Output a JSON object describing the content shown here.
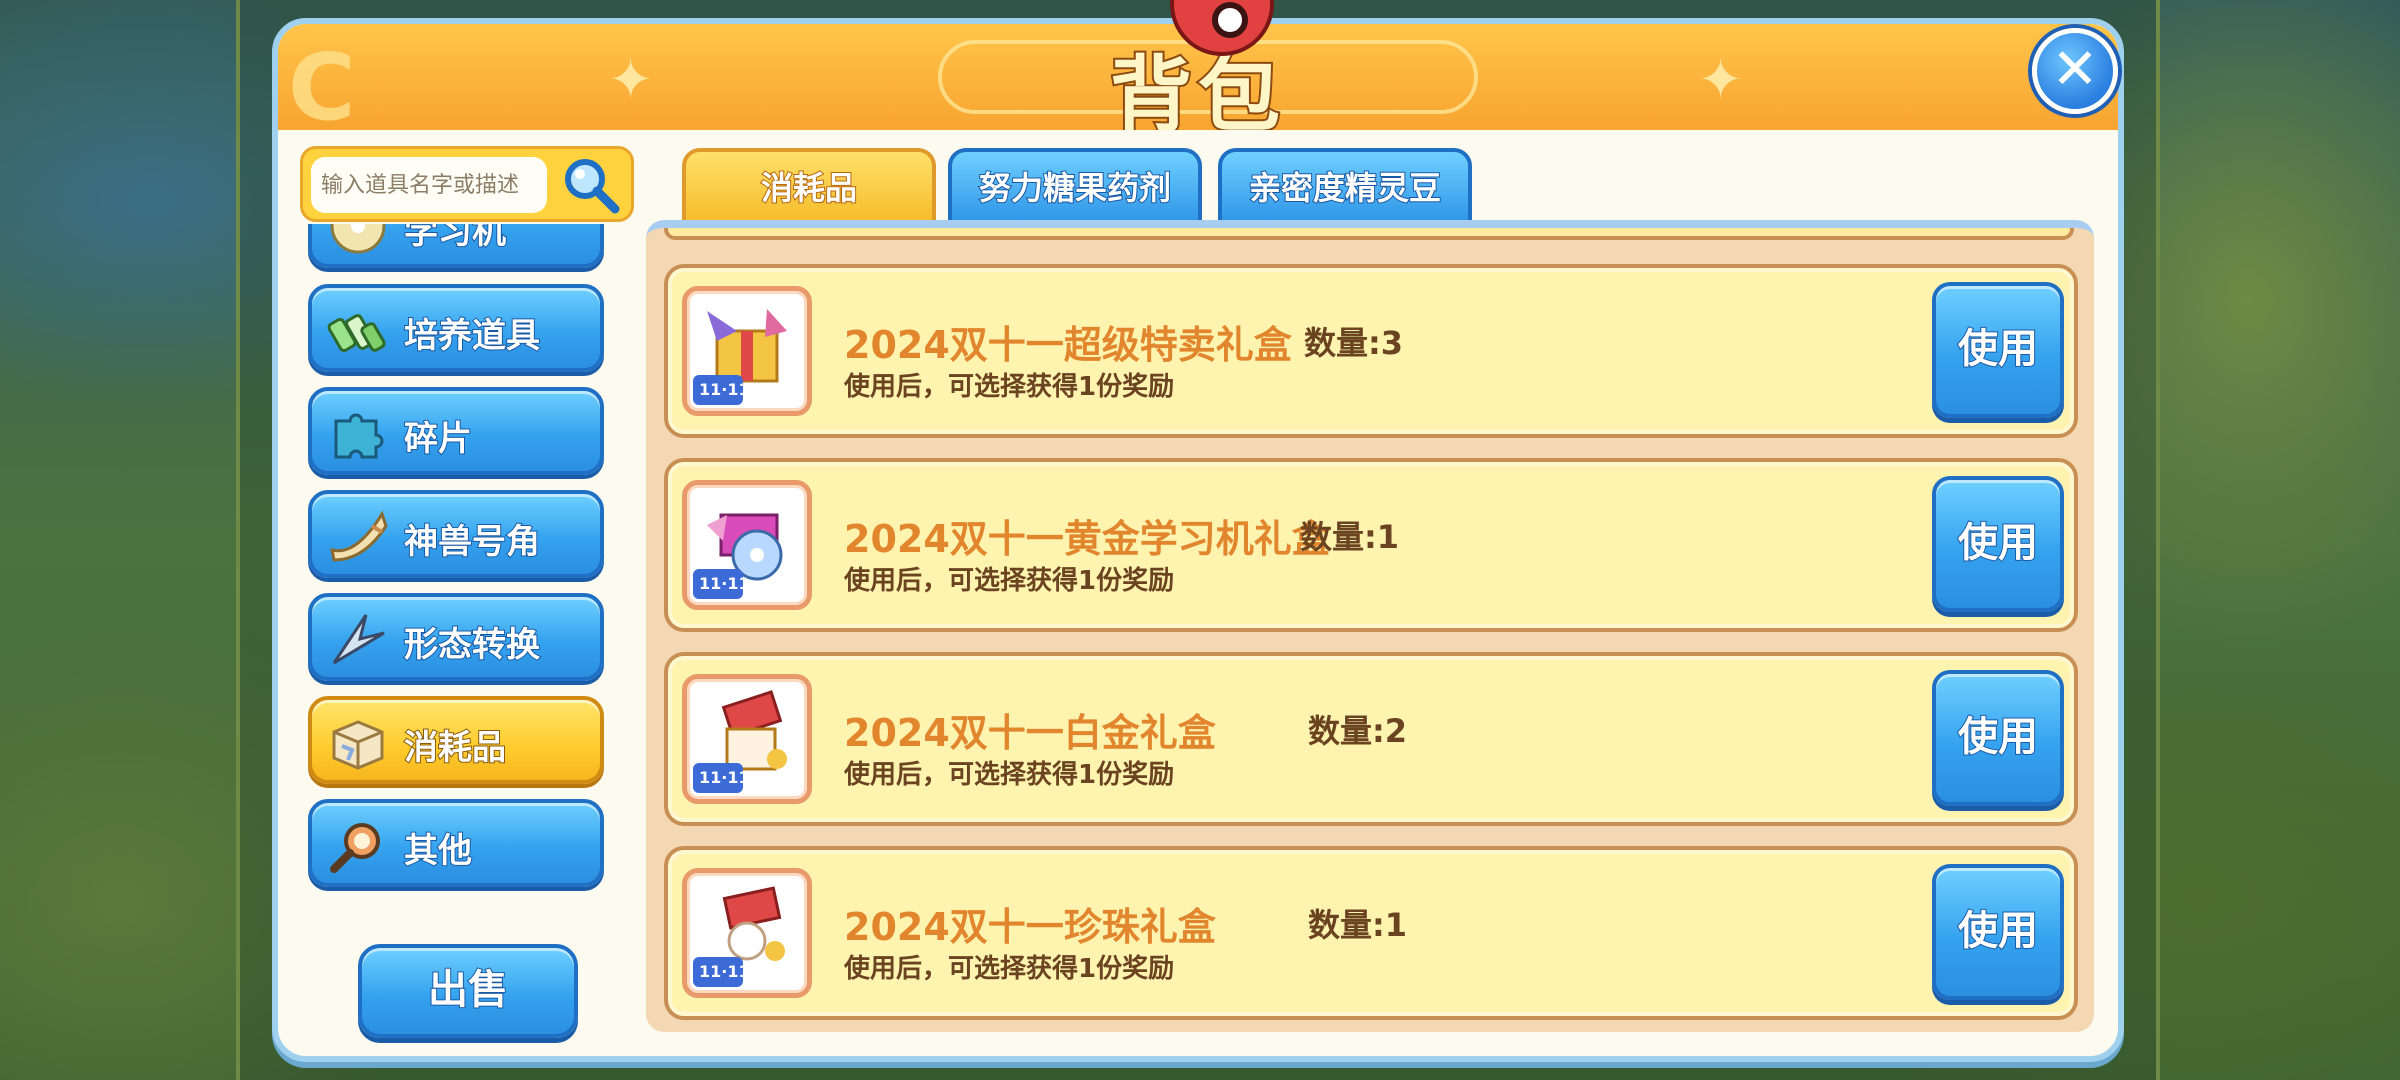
{
  "window": {
    "title": "背包",
    "close_label": "✕"
  },
  "search": {
    "placeholder": "输入道具名字或描述"
  },
  "sidebar": {
    "items": [
      {
        "label": "学习机",
        "icon": "disc-icon",
        "active": false
      },
      {
        "label": "培养道具",
        "icon": "bottles-icon",
        "active": false
      },
      {
        "label": "碎片",
        "icon": "puzzle-icon",
        "active": false
      },
      {
        "label": "神兽号角",
        "icon": "horn-icon",
        "active": false
      },
      {
        "label": "形态转换",
        "icon": "crystal-icon",
        "active": false
      },
      {
        "label": "消耗品",
        "icon": "gift-box-icon",
        "active": true
      },
      {
        "label": "其他",
        "icon": "magnifier-icon",
        "active": false
      }
    ],
    "sell_label": "出售"
  },
  "tabs": [
    {
      "label": "消耗品",
      "active": true
    },
    {
      "label": "努力糖果药剂",
      "active": false
    },
    {
      "label": "亲密度精灵豆",
      "active": false
    }
  ],
  "items": [
    {
      "name": "2024双十一超级特卖礼盒",
      "quantity": "数量:3",
      "description": "使用后，可选择获得1份奖励",
      "use_label": "使用"
    },
    {
      "name": "2024双十一黄金学习机礼盒",
      "quantity": "数量:1",
      "description": "使用后，可选择获得1份奖励",
      "use_label": "使用"
    },
    {
      "name": "2024双十一白金礼盒",
      "quantity": "数量:2",
      "description": "使用后，可选择获得1份奖励",
      "use_label": "使用"
    },
    {
      "name": "2024双十一珍珠礼盒",
      "quantity": "数量:1",
      "description": "使用后，可选择获得1份奖励",
      "use_label": "使用"
    }
  ],
  "colors": {
    "header": "#f8a431",
    "button_blue": "#35a3ef",
    "active_yellow": "#ffcc2e",
    "item_bg": "#fff3b0",
    "item_name": "#e2862d"
  }
}
